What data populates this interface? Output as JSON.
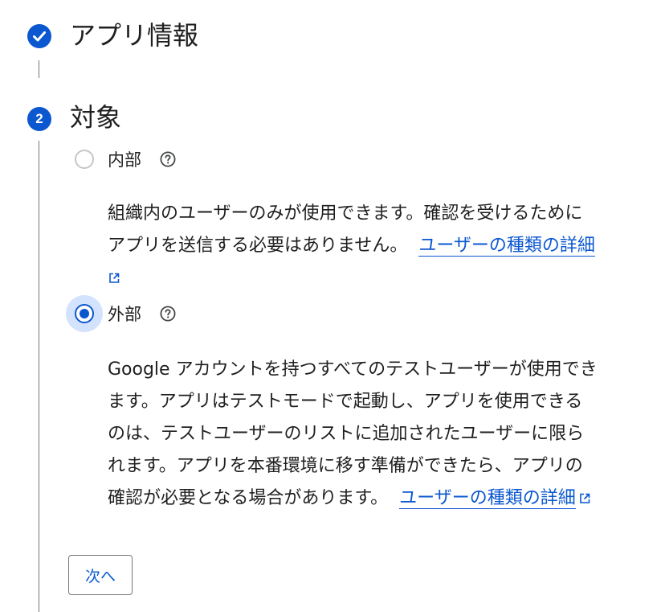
{
  "steps": [
    {
      "title": "アプリ情報",
      "state": "completed",
      "icon": "check-circle-icon"
    },
    {
      "title": "対象",
      "number": "2",
      "state": "active"
    }
  ],
  "audience": {
    "options": [
      {
        "label": "内部",
        "checked": false,
        "help_icon": "help-circle-icon",
        "description_lines": [
          "組織内のユーザーのみが使用できます。確認を受けるために",
          "アプリを送信する必要はありません。"
        ],
        "link_text": "ユーザーの種類の詳細"
      },
      {
        "label": "外部",
        "checked": true,
        "help_icon": "help-circle-icon",
        "description_lines": [
          "Google アカウントを持つすべてのテストユーザーが使用でき",
          "ます。アプリはテストモードで起動し、アプリを使用できる",
          "のは、テストユーザーのリストに追加されたユーザーに限ら",
          "れます。アプリを本番環境に移す準備ができたら、アプリの",
          "確認が必要となる場合があります。"
        ],
        "link_text": "ユーザーの種類の詳細"
      }
    ]
  },
  "next_button_label": "次へ",
  "colors": {
    "accent": "#0b57d0",
    "text": "#1f1f1f",
    "focus_ring": "#d3e3fd",
    "connector": "#747775"
  }
}
